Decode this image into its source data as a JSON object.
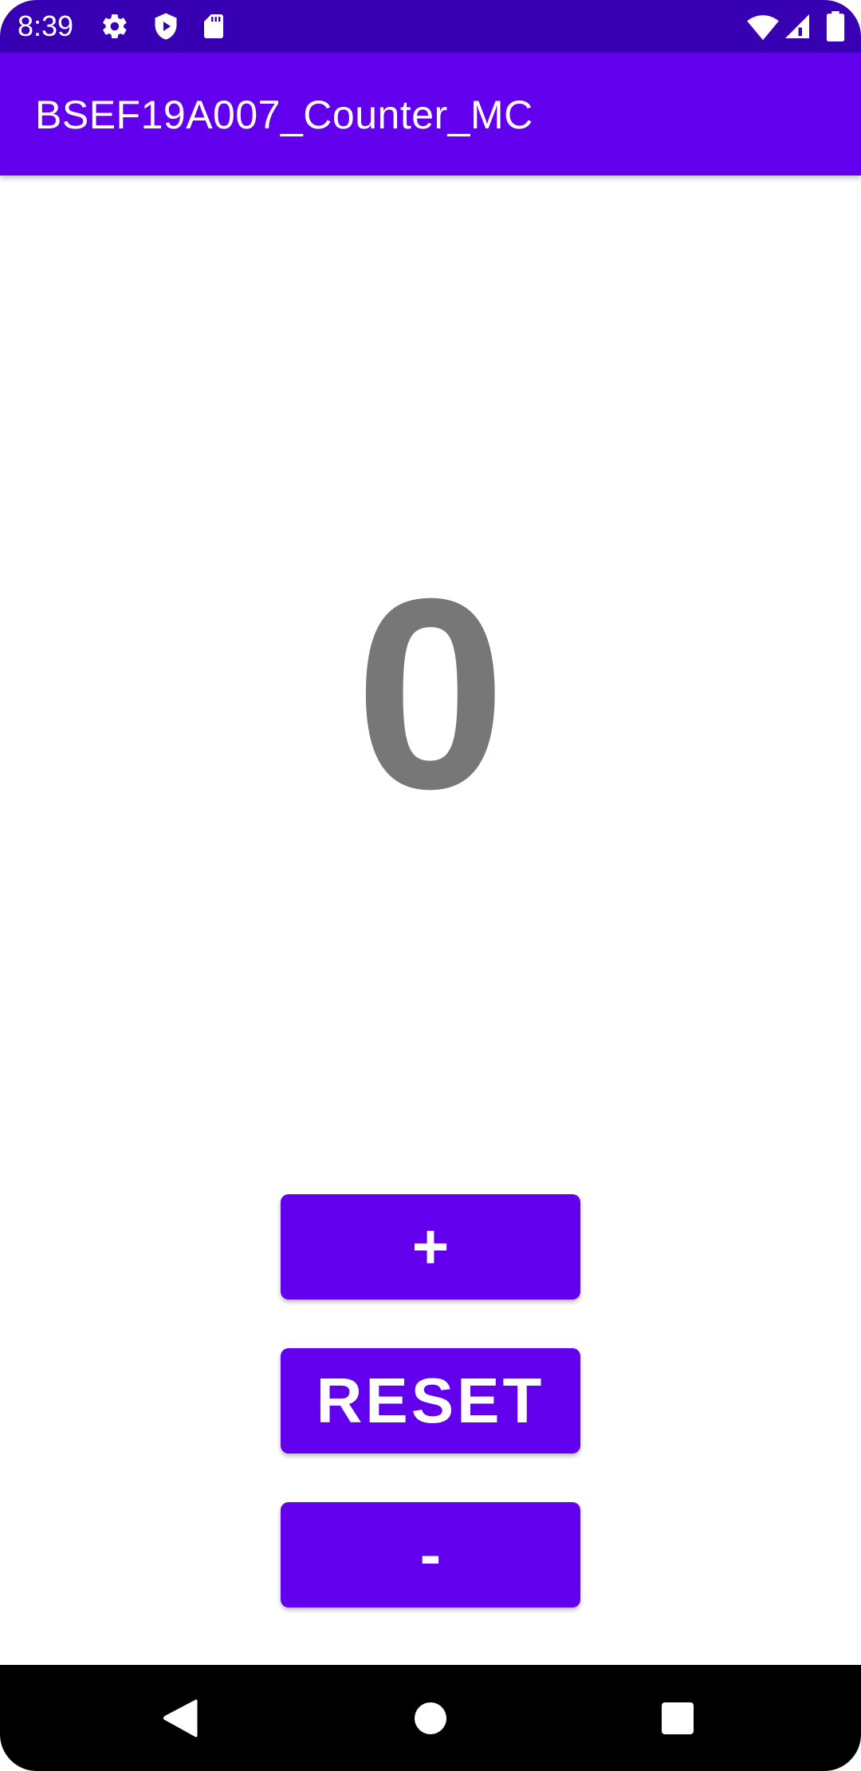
{
  "status_bar": {
    "time": "8:39",
    "icons": [
      "settings-icon",
      "play-protect-icon",
      "sd-card-icon",
      "wifi-icon",
      "signal-icon",
      "battery-icon"
    ],
    "background": "#3700b3"
  },
  "app_bar": {
    "title": "BSEF19A007_Counter_MC",
    "background": "#6200ee"
  },
  "counter": {
    "value": "0",
    "color": "#777777"
  },
  "buttons": {
    "increment_label": "+",
    "reset_label": "RESET",
    "decrement_label": "-",
    "color": "#6200ee"
  },
  "nav_bar": {
    "icons": [
      "back-icon",
      "home-icon",
      "recents-icon"
    ]
  }
}
